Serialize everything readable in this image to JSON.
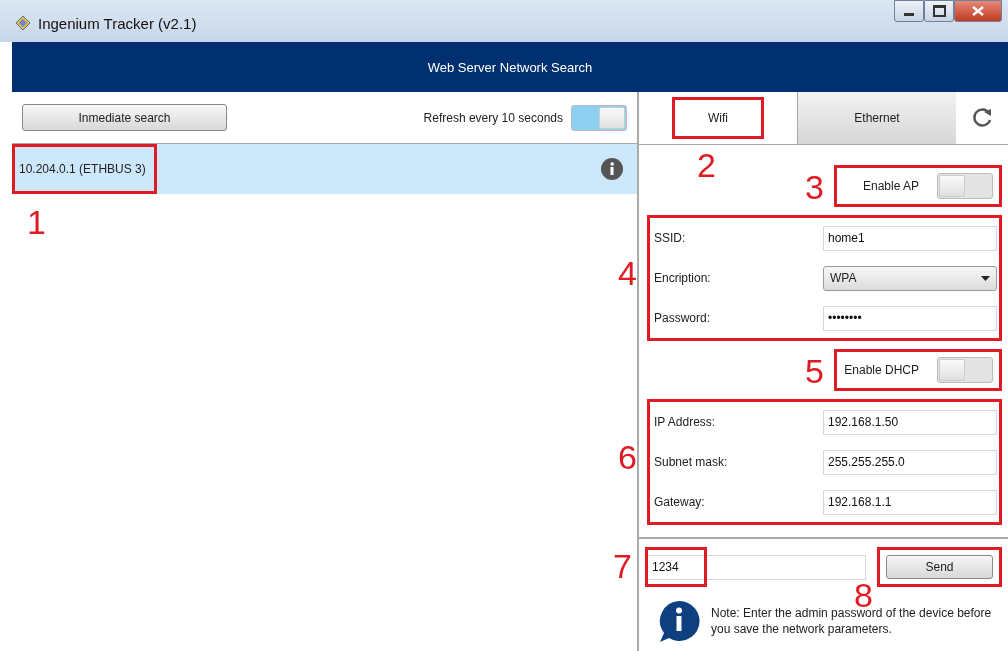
{
  "window": {
    "title": "Ingenium Tracker (v2.1)"
  },
  "header": {
    "title": "Web Server Network Search"
  },
  "search_bar": {
    "search_button": "Inmediate search",
    "refresh_label": "Refresh every 10 seconds",
    "refresh_on": true
  },
  "devices": [
    {
      "name": "10.204.0.1 (ETHBUS 3)",
      "selected": true,
      "callout": "1"
    }
  ],
  "tabs": [
    {
      "label": "Wifi",
      "selected": true,
      "callout": "2"
    },
    {
      "label": "Ethernet",
      "selected": false
    }
  ],
  "enable_ap": {
    "label": "Enable AP",
    "on": false,
    "callout": "3"
  },
  "wifi_fields": {
    "callout": "4",
    "fields": [
      {
        "kind": "text",
        "label": "SSID:",
        "value": "home1"
      },
      {
        "kind": "dropdown",
        "label": "Encription:",
        "value": "WPA"
      },
      {
        "kind": "text",
        "label": "Password:",
        "value": "••••••••"
      }
    ]
  },
  "enable_dhcp": {
    "label": "Enable DHCP",
    "on": false,
    "callout": "5"
  },
  "ip_fields": {
    "callout": "6",
    "fields": [
      {
        "kind": "text",
        "label": "IP Address:",
        "value": "192.168.1.50"
      },
      {
        "kind": "text",
        "label": "Subnet mask:",
        "value": "255.255.255.0"
      },
      {
        "kind": "text",
        "label": "Gateway:",
        "value": "192.168.1.1"
      }
    ]
  },
  "admin": {
    "password": "1234",
    "password_callout": "7",
    "send_button": "Send",
    "send_callout": "8",
    "note": "Note: Enter the admin password of the device before you save the network parameters."
  }
}
